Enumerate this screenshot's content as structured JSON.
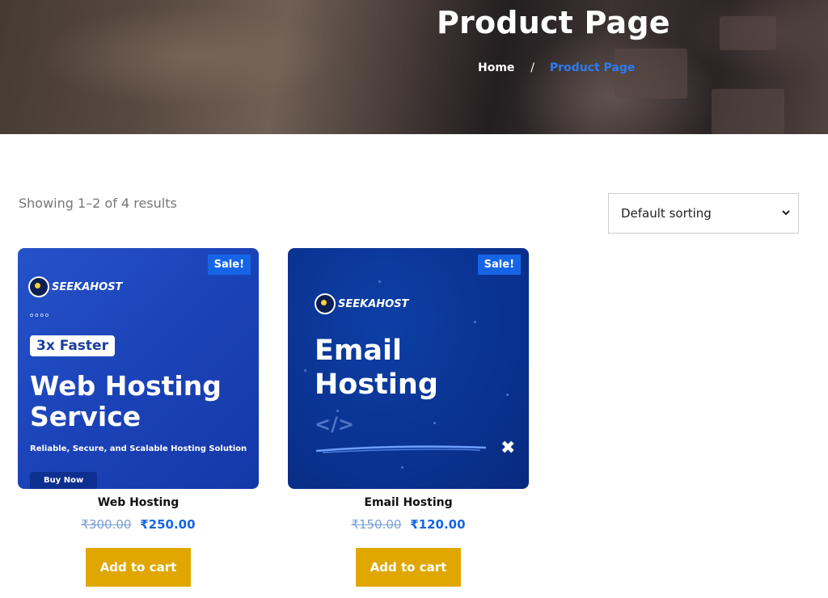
{
  "hero": {
    "title": "Product Page",
    "breadcrumb": {
      "home": "Home",
      "separator": "/",
      "current": "Product Page"
    }
  },
  "shop": {
    "result_count": "Showing 1–2 of 4 results",
    "sort": {
      "selected": "Default sorting"
    }
  },
  "products": [
    {
      "name": "Web Hosting",
      "badge": "Sale!",
      "old_price": "₹300.00",
      "price": "₹250.00",
      "button": "Add to cart",
      "image": {
        "logo": "SEEKAHOST",
        "dots": "oooo",
        "pill": "3x Faster",
        "headline_1": "Web Hosting",
        "headline_2": "Service",
        "tagline": "Reliable, Secure, and Scalable Hosting Solution",
        "cta": "Buy Now"
      }
    },
    {
      "name": "Email Hosting",
      "badge": "Sale!",
      "old_price": "₹150.00",
      "price": "₹120.00",
      "button": "Add to cart",
      "image": {
        "logo": "SEEKAHOST",
        "headline_1": "Email",
        "headline_2": "Hosting",
        "code_glyph": "</>",
        "x_glyph": "✖"
      }
    }
  ],
  "colors": {
    "accent": "#1665e6",
    "button": "#e0a700",
    "breadcrumb_current": "#2d7bf0"
  },
  "icons": [
    "chevron-down-icon",
    "owl-logo-icon",
    "code-icon",
    "close-x-icon"
  ]
}
